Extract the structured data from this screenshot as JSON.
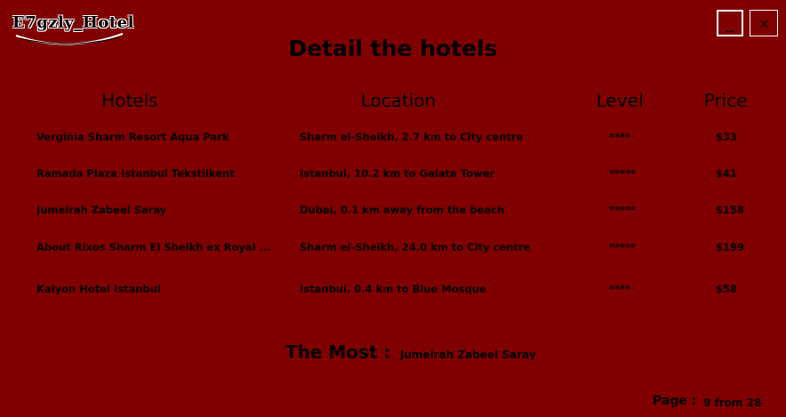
{
  "app": {
    "logo_text": "E7gzly_Hotel",
    "minimize_label": "_",
    "close_label": "×"
  },
  "page_title": "Detail the hotels",
  "table": {
    "headers": {
      "hotel": "Hotels",
      "location": "Location",
      "level": "Level",
      "price": "Price"
    },
    "rows": [
      {
        "hotel": "Verginia Sharm Resort  Aqua Park",
        "location": "Sharm el-Sheikh, 2.7 km to City centre",
        "level": "****",
        "price": "$33"
      },
      {
        "hotel": "Ramada Plaza Istanbul Tekstilkent",
        "location": "Istanbul, 10.2 km to Galata Tower",
        "level": "*****",
        "price": "$41"
      },
      {
        "hotel": "Jumeirah Zabeel Saray",
        "location": "Dubai, 0.1 km away from the beach",
        "level": "*****",
        "price": "$158"
      },
      {
        "hotel": "About Rixos Sharm El Sheikh ex Royal ...",
        "location": "Sharm el-Sheikh, 24.0 km to City centre",
        "level": "*****",
        "price": "$199"
      },
      {
        "hotel": "Kalyon Hotel Istanbul",
        "location": "Istanbul, 0.4 km to Blue Mosque",
        "level": "****",
        "price": "$58"
      }
    ]
  },
  "most": {
    "label": "The Most :",
    "value": "Jumeirah Zabeel Saray"
  },
  "pagination": {
    "label": "Page :",
    "value": "9 from 28"
  },
  "colors": {
    "background": "#800000",
    "text": "#000000",
    "border": "#ffffff"
  }
}
